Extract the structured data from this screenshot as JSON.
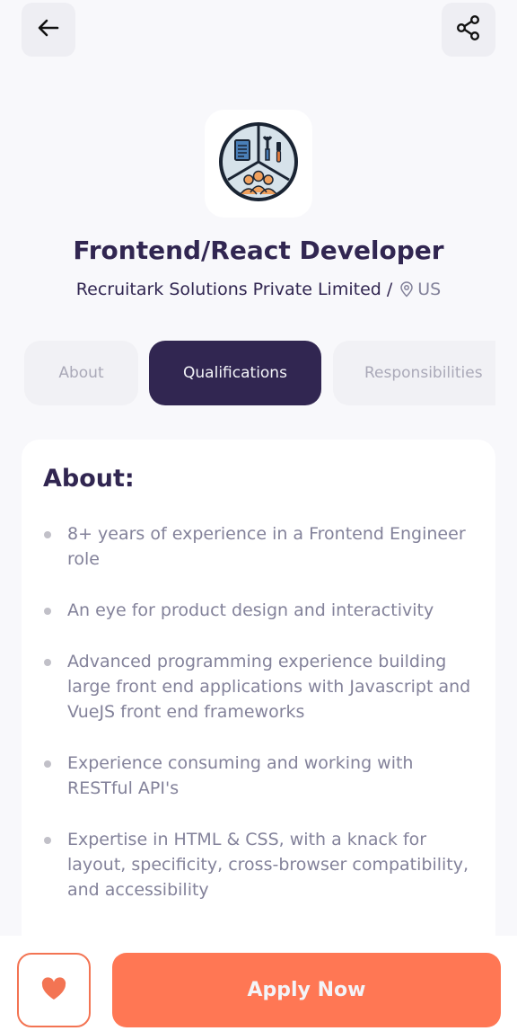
{
  "header": {
    "back_icon": "arrow-left-icon",
    "share_icon": "share-icon"
  },
  "job": {
    "logo_icon": "company-logo-icon",
    "title": "Frontend/React Developer",
    "company": "Recruitark Solutions Private Limited",
    "separator": "/",
    "location_icon": "location-pin-icon",
    "location": "US"
  },
  "tabs": [
    {
      "label": "About",
      "active": false
    },
    {
      "label": "Qualifications",
      "active": true
    },
    {
      "label": "Responsibilities",
      "active": false
    }
  ],
  "content": {
    "heading": "About:",
    "items": [
      "8+ years of experience in a Frontend Engineer role",
      "An eye for product design and interactivity",
      "Advanced programming experience building large front end applications with Javascript and VueJS front end frameworks",
      "Experience consuming and working with RESTful API's",
      "Expertise in HTML & CSS, with a knack for layout, specificity, cross-browser compatibility, and accessibility"
    ]
  },
  "footer": {
    "like_icon": "heart-icon",
    "apply_label": "Apply Now"
  },
  "colors": {
    "primary": "#312651",
    "accent": "#ff7754",
    "gray": "#83829a",
    "background": "#f8f8fb"
  }
}
